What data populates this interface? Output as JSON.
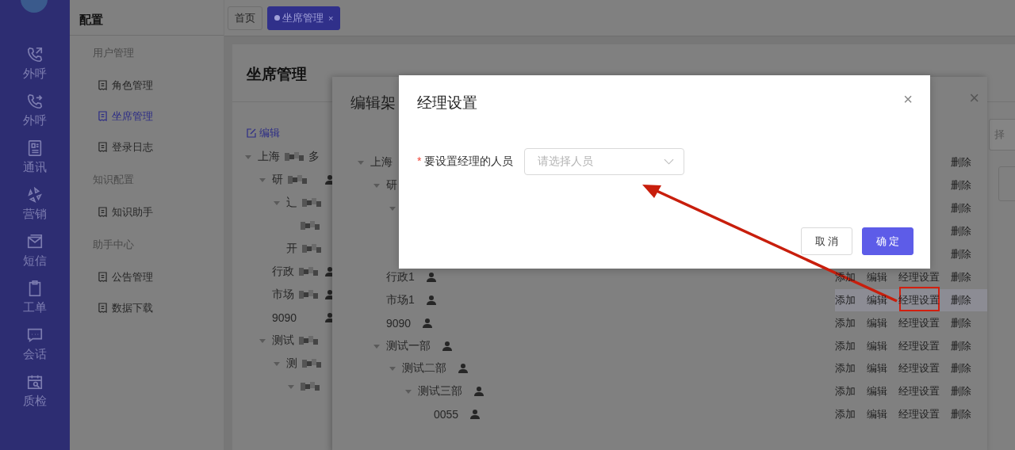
{
  "nav": [
    {
      "label": "外呼",
      "kind": "phone-out"
    },
    {
      "label": "外呼",
      "kind": "phone-forward"
    },
    {
      "label": "通讯",
      "kind": "contacts"
    },
    {
      "label": "营销",
      "kind": "pinwheel"
    },
    {
      "label": "短信",
      "kind": "mail"
    },
    {
      "label": "工单",
      "kind": "clipboard"
    },
    {
      "label": "会话",
      "kind": "chat"
    },
    {
      "label": "质检",
      "kind": "calendar"
    }
  ],
  "submenu": {
    "title": "配置",
    "groups": [
      {
        "label": "用户管理",
        "items": [
          {
            "label": "角色管理",
            "selected": false
          },
          {
            "label": "坐席管理",
            "selected": true
          },
          {
            "label": "登录日志",
            "selected": false
          }
        ]
      },
      {
        "label": "知识配置",
        "items": [
          {
            "label": "知识助手",
            "selected": false
          }
        ]
      },
      {
        "label": "助手中心",
        "items": [
          {
            "label": "公告管理",
            "selected": false
          },
          {
            "label": "数据下载",
            "selected": false
          }
        ]
      }
    ]
  },
  "tabs": [
    {
      "label": "首页",
      "selected": false
    },
    {
      "label": "坐席管理",
      "selected": true,
      "close": "×"
    }
  ],
  "page": {
    "title": "坐席管理",
    "edit_link": "编辑",
    "tree": [
      {
        "label": "上海",
        "masked": true,
        "tail": "多",
        "expanded": true,
        "children": [
          {
            "label": "研",
            "masked": true,
            "person": true,
            "expanded": true,
            "children": [
              {
                "masked": true,
                "label": "辶",
                "expanded": true,
                "children": [
                  {
                    "masked": true
                  }
                ]
              },
              {
                "label": "开",
                "masked": true
              }
            ]
          },
          {
            "label": "行政",
            "masked": true,
            "person": true
          },
          {
            "label": "市场",
            "masked": true,
            "person": true
          },
          {
            "label": "9090",
            "person": true
          },
          {
            "label": "测试",
            "masked": true,
            "expanded": true,
            "children": [
              {
                "label": "测",
                "masked": true,
                "expanded": true,
                "children": [
                  {
                    "masked": true,
                    "expanded": true
                  }
                ]
              }
            ]
          }
        ]
      }
    ]
  },
  "drawer": {
    "title": "编辑架",
    "close": "×",
    "search_text": "择",
    "tree": [
      {
        "label": "上海",
        "expanded": true,
        "actions": [
          {
            "kind": "delete",
            "label": "删除"
          }
        ],
        "children": [
          {
            "label": "研",
            "expanded": true,
            "actions": [
              {
                "kind": "delete",
                "label": "删除"
              }
            ],
            "children": [
              {
                "expanded": true,
                "actions": [
                  {
                    "kind": "delete",
                    "label": "删除"
                  }
                ],
                "children": [
                  {
                    "actions": [
                      {
                        "kind": "delete",
                        "label": "删除"
                      }
                    ]
                  }
                ]
              },
              {
                "actions": [
                  {
                    "kind": "delete",
                    "label": "删除"
                  }
                ]
              }
            ]
          },
          {
            "label": "行政1",
            "person": true,
            "actions": [
              {
                "kind": "add",
                "label": "添加"
              },
              {
                "kind": "edit",
                "label": "编辑"
              },
              {
                "kind": "manager",
                "label": "经理设置"
              },
              {
                "kind": "delete",
                "label": "删除"
              }
            ]
          },
          {
            "label": "市场1",
            "person": true,
            "highlighted": true,
            "actions": [
              {
                "kind": "add",
                "label": "添加"
              },
              {
                "kind": "edit",
                "label": "编辑"
              },
              {
                "kind": "manager",
                "label": "经理设置"
              },
              {
                "kind": "delete",
                "label": "删除"
              }
            ]
          },
          {
            "label": "9090",
            "person": true,
            "actions": [
              {
                "kind": "add",
                "label": "添加"
              },
              {
                "kind": "edit",
                "label": "编辑"
              },
              {
                "kind": "manager",
                "label": "经理设置"
              },
              {
                "kind": "delete",
                "label": "删除"
              }
            ]
          },
          {
            "label": "测试一部",
            "person": true,
            "expanded": true,
            "actions": [
              {
                "kind": "add",
                "label": "添加"
              },
              {
                "kind": "edit",
                "label": "编辑"
              },
              {
                "kind": "manager",
                "label": "经理设置"
              },
              {
                "kind": "delete",
                "label": "删除"
              }
            ],
            "children": [
              {
                "label": "测试二部",
                "person": true,
                "expanded": true,
                "actions": [
                  {
                    "kind": "add",
                    "label": "添加"
                  },
                  {
                    "kind": "edit",
                    "label": "编辑"
                  },
                  {
                    "kind": "manager",
                    "label": "经理设置"
                  },
                  {
                    "kind": "delete",
                    "label": "删除"
                  }
                ],
                "children": [
                  {
                    "label": "测试三部",
                    "person": true,
                    "expanded": true,
                    "actions": [
                      {
                        "kind": "add",
                        "label": "添加"
                      },
                      {
                        "kind": "edit",
                        "label": "编辑"
                      },
                      {
                        "kind": "manager",
                        "label": "经理设置"
                      },
                      {
                        "kind": "delete",
                        "label": "删除"
                      }
                    ],
                    "children": [
                      {
                        "label": "0055",
                        "person": true,
                        "actions": [
                          {
                            "kind": "add",
                            "label": "添加"
                          },
                          {
                            "kind": "edit",
                            "label": "编辑"
                          },
                          {
                            "kind": "manager",
                            "label": "经理设置"
                          },
                          {
                            "kind": "delete",
                            "label": "删除"
                          }
                        ]
                      }
                    ]
                  }
                ]
              }
            ]
          }
        ]
      }
    ]
  },
  "modal": {
    "title": "经理设置",
    "close": "×",
    "field": {
      "label": "要设置经理的人员",
      "required": true,
      "required_mark": "*",
      "placeholder": "请选择人员"
    },
    "buttons": [
      {
        "label": "取 消",
        "kind": "secondary"
      },
      {
        "label": "确 定",
        "kind": "primary"
      }
    ]
  }
}
